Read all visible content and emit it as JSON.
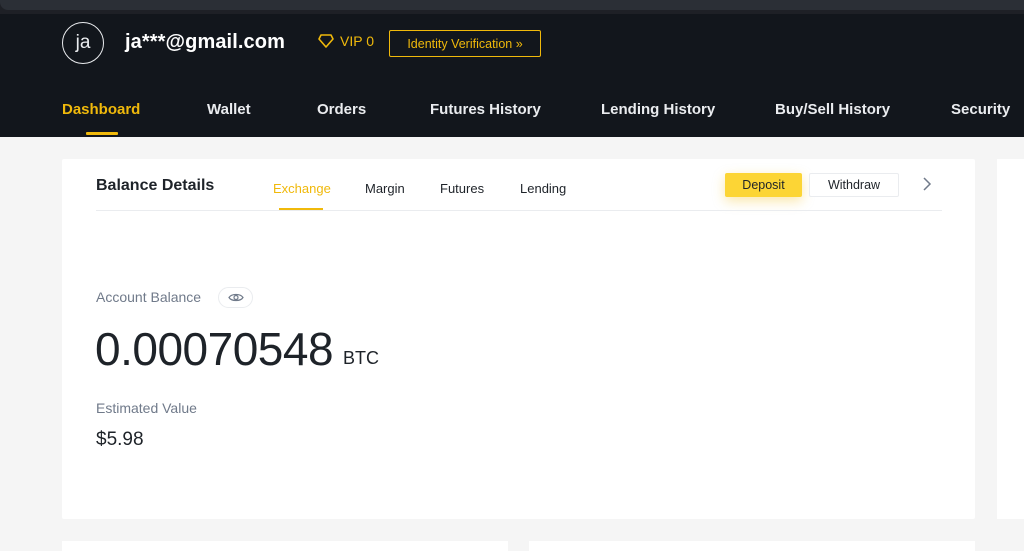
{
  "header": {
    "avatar_initials": "ja",
    "email": "ja***@gmail.com",
    "vip_label": "VIP 0",
    "identity_button": "Identity Verification »",
    "accent_color": "#f0b90b",
    "icons": {
      "vip": "diamond-icon"
    }
  },
  "nav": {
    "items": [
      {
        "label": "Dashboard",
        "active": true
      },
      {
        "label": "Wallet"
      },
      {
        "label": "Orders"
      },
      {
        "label": "Futures History"
      },
      {
        "label": "Lending History"
      },
      {
        "label": "Buy/Sell History"
      },
      {
        "label": "Security"
      }
    ]
  },
  "balance_card": {
    "title": "Balance Details",
    "tabs": [
      {
        "label": "Exchange",
        "active": true
      },
      {
        "label": "Margin"
      },
      {
        "label": "Futures"
      },
      {
        "label": "Lending"
      }
    ],
    "deposit_label": "Deposit",
    "withdraw_label": "Withdraw",
    "account_balance_label": "Account Balance",
    "balance_value": "0.00070548",
    "balance_unit": "BTC",
    "estimated_value_label": "Estimated Value",
    "estimated_value": "$5.98",
    "icons": {
      "toggle_visibility": "eye-icon",
      "more": "chevron-right-icon"
    }
  }
}
